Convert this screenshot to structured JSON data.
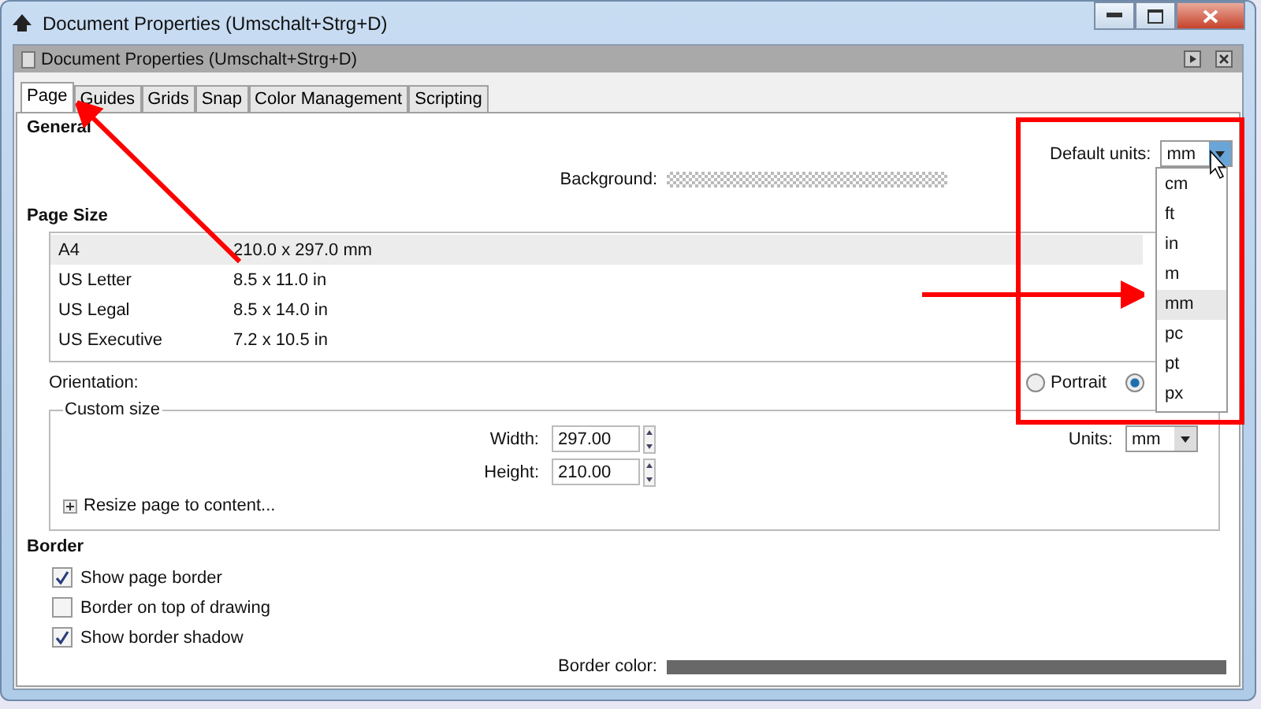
{
  "window": {
    "title": "Document Properties (Umschalt+Strg+D)"
  },
  "dock_title": "Document Properties (Umschalt+Strg+D)",
  "tabs": [
    {
      "label": "Page",
      "selected": true
    },
    {
      "label": "Guides",
      "selected": false
    },
    {
      "label": "Grids",
      "selected": false
    },
    {
      "label": "Snap",
      "selected": false
    },
    {
      "label": "Color Management",
      "selected": false
    },
    {
      "label": "Scripting",
      "selected": false
    }
  ],
  "general": {
    "heading": "General",
    "background_label": "Background:",
    "default_units_label": "Default units:",
    "default_units_value": "mm"
  },
  "units_menu": [
    {
      "label": "cm",
      "selected": false
    },
    {
      "label": "ft",
      "selected": false
    },
    {
      "label": "in",
      "selected": false
    },
    {
      "label": "m",
      "selected": false
    },
    {
      "label": "mm",
      "selected": true
    },
    {
      "label": "pc",
      "selected": false
    },
    {
      "label": "pt",
      "selected": false
    },
    {
      "label": "px",
      "selected": false
    }
  ],
  "page_size": {
    "heading": "Page Size",
    "rows": [
      {
        "name": "A4",
        "size": "210.0 x 297.0 mm",
        "selected": true
      },
      {
        "name": "US Letter",
        "size": "8.5 x 11.0 in",
        "selected": false
      },
      {
        "name": "US Legal",
        "size": "8.5 x 14.0 in",
        "selected": false
      },
      {
        "name": "US Executive",
        "size": "7.2 x 10.5 in",
        "selected": false
      }
    ],
    "orientation_label": "Orientation:",
    "orientation_options": [
      {
        "label": "Portrait",
        "selected": false
      },
      {
        "selected": true
      }
    ]
  },
  "custom_size": {
    "legend": "Custom size",
    "width_label": "Width:",
    "width_value": "297.00",
    "height_label": "Height:",
    "height_value": "210.00",
    "units_label": "Units:",
    "units_value": "mm",
    "resize_label": "Resize page to content...",
    "resize_expanded": false
  },
  "border": {
    "heading": "Border",
    "options": [
      {
        "label": "Show page border",
        "checked": true
      },
      {
        "label": "Border on top of drawing",
        "checked": false
      },
      {
        "label": "Show border shadow",
        "checked": true
      }
    ],
    "color_label": "Border color:",
    "color": "#686868"
  }
}
